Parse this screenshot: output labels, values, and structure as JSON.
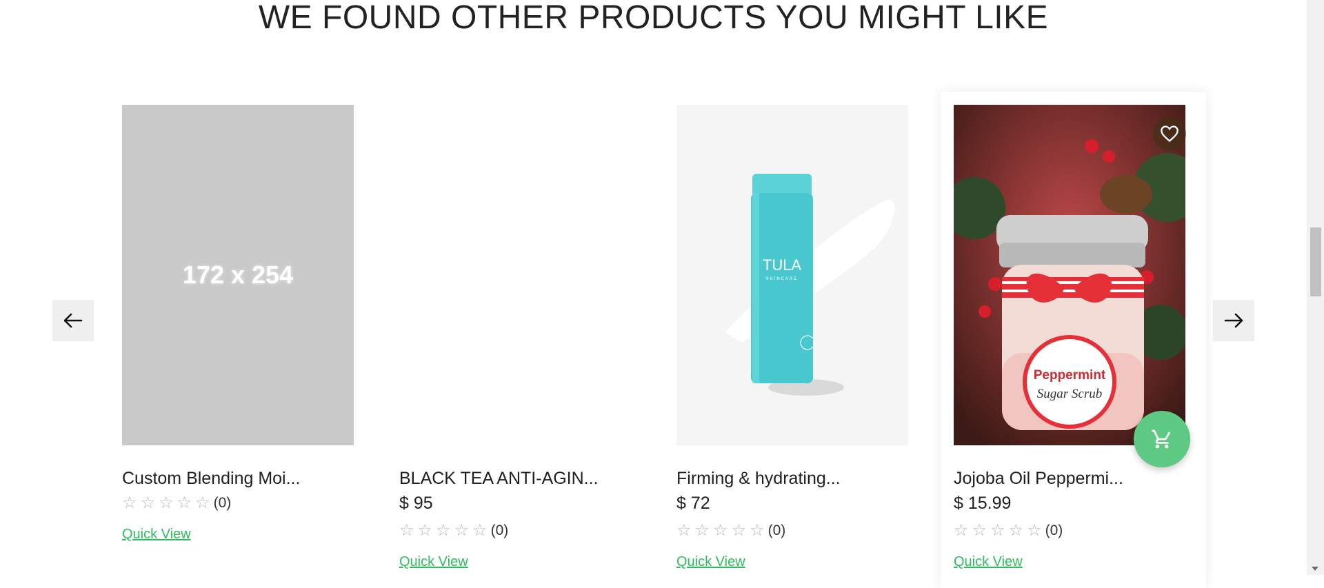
{
  "section": {
    "title": "WE FOUND OTHER PRODUCTS YOU MIGHT LIKE"
  },
  "carousel": {
    "prev_icon": "arrow-left-icon",
    "next_icon": "arrow-right-icon"
  },
  "products": [
    {
      "name": "Custom Blending Moi...",
      "price": "",
      "rating_count": "(0)",
      "quick_view": "Quick View",
      "image_text": "172 x 254"
    },
    {
      "name": "BLACK TEA ANTI-AGIN...",
      "price": "$ 95",
      "rating_count": "(0)",
      "quick_view": "Quick View"
    },
    {
      "name": "Firming & hydrating...",
      "price": "$ 72",
      "rating_count": "(0)",
      "quick_view": "Quick View"
    },
    {
      "name": "Jojoba Oil Peppermi...",
      "price": "$ 15.99",
      "rating_count": "(0)",
      "quick_view": "Quick View"
    }
  ],
  "product_images": {
    "tula_brand": "TULA",
    "tula_sub": "SKINCARE",
    "scrub_label_1": "Peppermint",
    "scrub_label_2": "Sugar Scrub"
  },
  "colors": {
    "accent": "#2ebd5c",
    "cart_button": "#5dc983",
    "placeholder": "#c9c9c9",
    "star": "#b9b9b9"
  },
  "icons": {
    "heart": "heart-icon",
    "cart": "cart-icon"
  }
}
